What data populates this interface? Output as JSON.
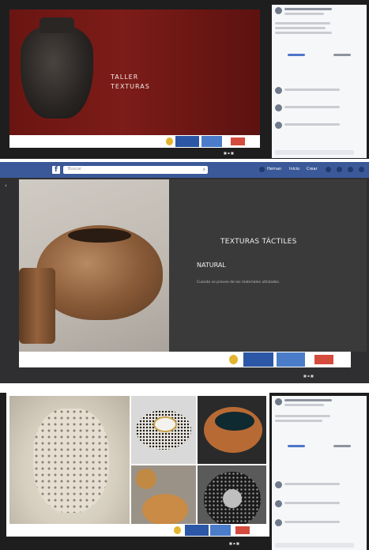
{
  "panel1": {
    "slide_title_line1": "TALLER",
    "slide_title_line2": "TEXTURAS"
  },
  "panel2": {
    "search_placeholder": "Buscar",
    "nav_user": "Hernan",
    "nav_home": "Inicio",
    "nav_create": "Crear",
    "slide_title": "TEXTURAS TÁCTILES",
    "slide_subtitle": "NATURAL",
    "slide_body": "Cuando se provee de los materiales utilizados."
  },
  "colors": {
    "facebook_blue": "#3b5998",
    "gov_blue": "#2c57a6",
    "gov_red": "#d54b3e",
    "slide_red": "#7d1c18",
    "slide_dark": "#3b3a3b"
  }
}
